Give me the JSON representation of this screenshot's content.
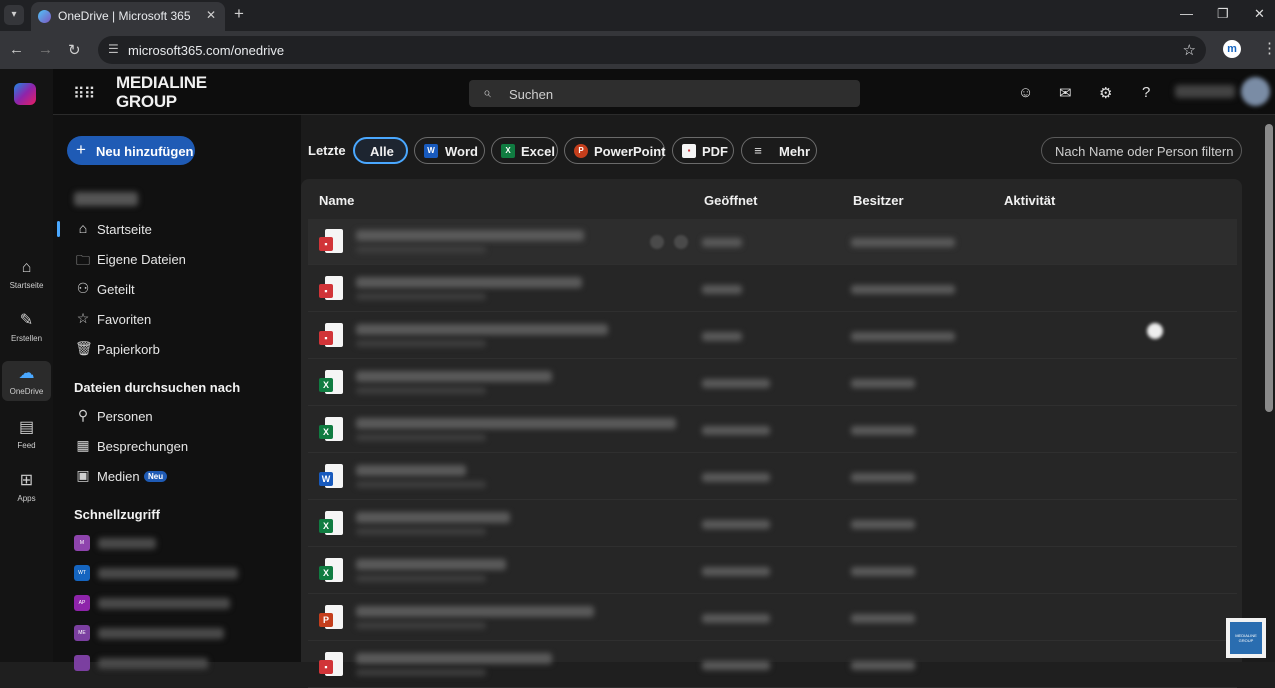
{
  "browser": {
    "tab_title": "OneDrive | Microsoft 365",
    "url": "microsoft365.com/onedrive"
  },
  "rail": {
    "items": [
      {
        "label": "Startseite",
        "icon": "home-icon"
      },
      {
        "label": "Erstellen",
        "icon": "pen-icon"
      },
      {
        "label": "OneDrive",
        "icon": "cloud-icon"
      },
      {
        "label": "Feed",
        "icon": "feed-icon"
      },
      {
        "label": "Apps",
        "icon": "apps-icon"
      }
    ]
  },
  "header": {
    "brand_line1": "MEDIALINE",
    "brand_line2": "GROUP",
    "search_placeholder": "Suchen"
  },
  "sidebar": {
    "add_button": "Neu hinzufügen",
    "items": [
      {
        "label": "Startseite",
        "icon": "home-icon"
      },
      {
        "label": "Eigene Dateien",
        "icon": "folder-icon"
      },
      {
        "label": "Geteilt",
        "icon": "people-icon"
      },
      {
        "label": "Favoriten",
        "icon": "star-icon"
      },
      {
        "label": "Papierkorb",
        "icon": "trash-icon"
      }
    ],
    "browse_heading": "Dateien durchsuchen nach",
    "browse_items": [
      {
        "label": "Personen",
        "icon": "person-icon"
      },
      {
        "label": "Besprechungen",
        "icon": "calendar-icon"
      },
      {
        "label": "Medien",
        "icon": "image-icon",
        "badge": "Neu"
      }
    ],
    "quick_heading": "Schnellzugriff",
    "quick_items": [
      {
        "tag": "M",
        "color": "#8e44ad"
      },
      {
        "tag": "WT",
        "color": "#1565c0"
      },
      {
        "tag": "AP",
        "color": "#8e24aa"
      },
      {
        "tag": "ME",
        "color": "#7b3fa0"
      },
      {
        "tag": "",
        "color": "#7b3fa0"
      }
    ]
  },
  "main": {
    "recent_label": "Letzte",
    "filters": [
      {
        "label": "Alle",
        "selected": true
      },
      {
        "label": "Word",
        "icon": "word-icon",
        "color": "#185abd"
      },
      {
        "label": "Excel",
        "icon": "excel-icon",
        "color": "#107c41"
      },
      {
        "label": "PowerPoint",
        "icon": "powerpoint-icon",
        "color": "#c43e1c"
      },
      {
        "label": "PDF",
        "icon": "pdf-icon",
        "color": "#d13438"
      },
      {
        "label": "Mehr",
        "icon": "filter-lines-icon"
      }
    ],
    "filter_placeholder": "Nach Name oder Person filtern",
    "columns": [
      "Name",
      "Geöffnet",
      "Besitzer",
      "Aktivität"
    ],
    "row_types": [
      "pdf",
      "pdf",
      "pdf",
      "excel",
      "excel",
      "word",
      "excel",
      "excel",
      "powerpoint",
      "pdf"
    ]
  },
  "colors": {
    "accent": "#4aa8ff",
    "primary_button": "#1f5bb5",
    "background": "#1b1b1b"
  }
}
